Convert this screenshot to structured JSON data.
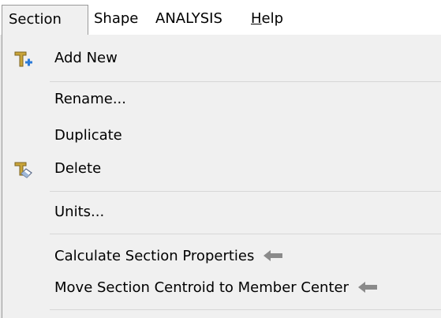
{
  "menubar": {
    "items": [
      {
        "label": "Section"
      },
      {
        "label": "Shape"
      },
      {
        "label": "ANALYSIS"
      },
      {
        "label_underline": "H",
        "label_rest": "elp"
      }
    ]
  },
  "dropdown": {
    "items": [
      {
        "label": "Add New",
        "icon": "add-section-icon"
      },
      {
        "label": "Rename..."
      },
      {
        "label": "Duplicate"
      },
      {
        "label": "Delete",
        "icon": "delete-section-icon"
      },
      {
        "label": "Units..."
      },
      {
        "label": "Calculate Section Properties",
        "arrow": "left-arrow-icon"
      },
      {
        "label": "Move Section Centroid to Member Center",
        "arrow": "left-arrow-icon"
      }
    ]
  },
  "colors": {
    "menu_bg": "#f0f0f0",
    "icon_gold": "#c9a53a",
    "icon_blue": "#2a7ad8",
    "arrow_gray": "#8a8a8a"
  }
}
